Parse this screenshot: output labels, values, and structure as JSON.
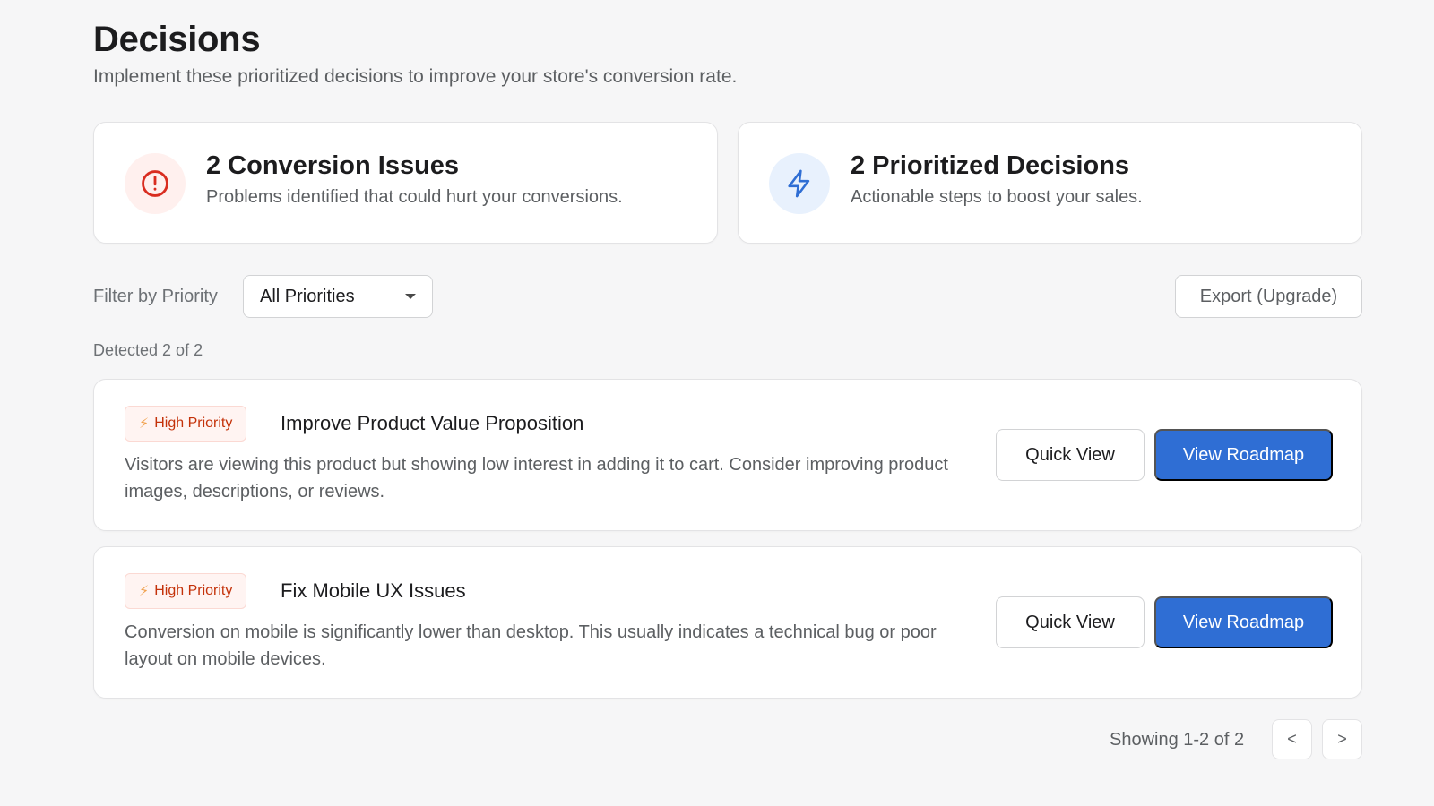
{
  "header": {
    "title": "Decisions",
    "subtitle": "Implement these prioritized decisions to improve your store's conversion rate."
  },
  "stats": [
    {
      "title": "2 Conversion Issues",
      "desc": "Problems identified that could hurt your conversions.",
      "icon": "alert-circle-icon",
      "color": "#d92d20"
    },
    {
      "title": "2 Prioritized Decisions",
      "desc": "Actionable steps to boost your sales.",
      "icon": "lightning-icon",
      "color": "#2f6ed4"
    }
  ],
  "filter": {
    "label": "Filter by Priority",
    "selected": "All Priorities"
  },
  "export_label": "Export (Upgrade)",
  "detected": "Detected 2 of 2",
  "decisions": [
    {
      "priority": "High Priority",
      "title": "Improve Product Value Proposition",
      "desc": "Visitors are viewing this product but showing low interest in adding it to cart. Consider improving product images, descriptions, or reviews.",
      "quick_view": "Quick View",
      "roadmap": "View Roadmap"
    },
    {
      "priority": "High Priority",
      "title": "Fix Mobile UX Issues",
      "desc": "Conversion on mobile is significantly lower than desktop. This usually indicates a technical bug or poor layout on mobile devices.",
      "quick_view": "Quick View",
      "roadmap": "View Roadmap"
    }
  ],
  "pagination": {
    "showing": "Showing 1-2 of 2",
    "prev": "<",
    "next": ">"
  },
  "colors": {
    "accent": "#2f6ed4",
    "danger": "#c4320a",
    "background": "#f6f6f7"
  }
}
